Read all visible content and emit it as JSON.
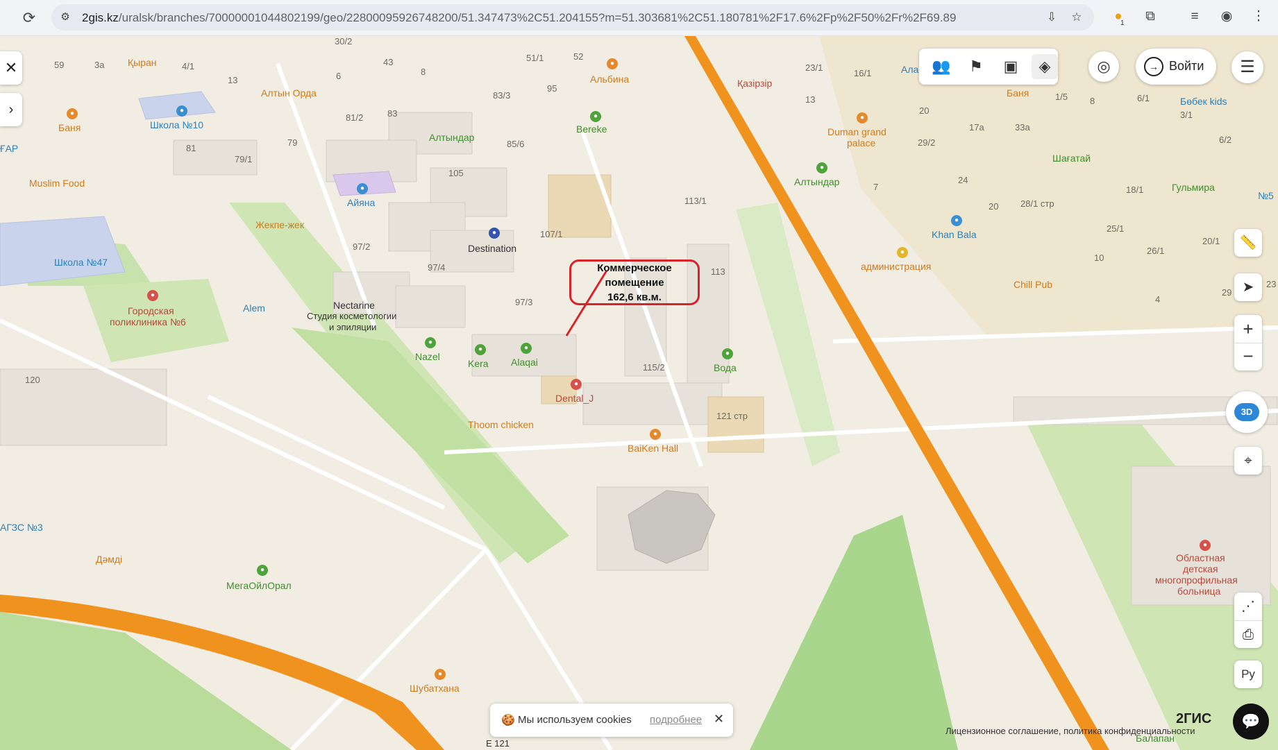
{
  "browser": {
    "url_host": "2gis.kz",
    "url_path": "/uralsk/branches/70000001044802199/geo/22800095926748200/51.347473%2C51.204155?m=51.303681%2C51.180781%2F17.6%2Fp%2F50%2Fr%2F69.89",
    "icons": [
      "reload-icon",
      "site-info-icon",
      "install-app-icon",
      "star-icon",
      "extension-badge-icon",
      "puzzle-icon",
      "media-icon",
      "profile-icon",
      "more-icon"
    ],
    "extension_badge": "1"
  },
  "map_ui": {
    "login_label": "Войти",
    "tools_icons": [
      "friends-icon",
      "directions-icon",
      "photo-icon",
      "layers-icon",
      "circle-icon",
      "menu-icon"
    ],
    "right_controls_icons": [
      "ruler-icon",
      "locate-icon",
      "zoom-in-icon",
      "zoom-out-icon",
      "compass-3d-icon",
      "map-pin-icon",
      "share-icon",
      "print-icon"
    ],
    "mode_3d_label": "3D",
    "language_label": "Ру",
    "cookie_text": "Мы используем cookies",
    "cookie_more": "подробнее",
    "brand": "2ГИС",
    "license": "Лицензионное соглашение, политика конфиденциальности"
  },
  "annotation": {
    "text": "Коммерческое\nпомещение\n162,6 кв.м.",
    "color": "#d8232a"
  },
  "map_labels": {
    "kyran": "Қыран",
    "altyn_orda": "Алтын Орда",
    "albina": "Альбина",
    "kazirzhr": "Қазірзір",
    "banya_l": "Баня",
    "shkola10": "Школа №10",
    "far": "ҒАР",
    "muslim_food": "Muslim Food",
    "shkola47": "Школа №47",
    "altyndar_top": "Алтындар",
    "bereke": "Bereke",
    "ayana": "Айяна",
    "zhekpe": "Жекпе-жек",
    "destination": "Destination",
    "nectarine": "Nectarine",
    "studio": "Студия косметологии",
    "epil": "и эпиляции",
    "alem": "Alem",
    "polyclinic1": "Городская",
    "polyclinic2": "поликлиника №6",
    "nazel": "Nazel",
    "kera": "Kera",
    "alaqai": "Alaqai",
    "voda": "Вода",
    "dental": "Dental_J",
    "thoom": "Thoom chicken",
    "baiken": "BaiKen Hall",
    "duman1": "Duman grand",
    "duman2": "palace",
    "altyndar_r": "Алтындар",
    "khan_bala": "Khan Bala",
    "admin": "администрация",
    "chill_pub": "Chill Pub",
    "banya_r": "Баня",
    "bobek": "Бөбек kids",
    "shagatai": "Шағатай",
    "gulmira": "Гульмира",
    "no5": "№5",
    "ala": "Ала",
    "azs": "АГЗС №3",
    "damdi": "Дәмді",
    "megaoil": "МегаОйлОрал",
    "shubatkhana": "Шубатхана",
    "hosp1": "Областная",
    "hosp2": "детская",
    "hosp3": "многопрофильная",
    "hosp4": "больница",
    "balapan": "Балапан",
    "e121": "E 121"
  },
  "house_numbers": {
    "n59": "59",
    "n3a": "3а",
    "n41": "4/1",
    "n302": "30/2",
    "n43": "43",
    "n511": "51/1",
    "n52": "52",
    "n13a": "13",
    "n6": "6",
    "n8": "8",
    "n95": "95",
    "n833": "83/3",
    "n812": "81/2",
    "n83": "83",
    "n856": "85/6",
    "n81": "81",
    "n791": "79/1",
    "n79": "79",
    "n105": "105",
    "n972": "97/2",
    "n974": "97/4",
    "n973": "97/3",
    "n1071": "107/1",
    "n1131": "113/1",
    "n113": "113",
    "n1152": "115/2",
    "n121": "121 стр",
    "n120": "120",
    "n231": "23/1",
    "n161": "16/1",
    "n13b": "13",
    "n7": "7",
    "n15": "1/5",
    "n8b": "8",
    "n61": "6/1",
    "n31": "3/1",
    "n20a": "20",
    "n17a": "17а",
    "n33a": "33а",
    "n292": "29/2",
    "n62": "6/2",
    "n24": "24",
    "n181": "18/1",
    "n20b": "20",
    "n281": "28/1 стр",
    "n251": "25/1",
    "n201": "20/1",
    "n10": "10",
    "n261": "26/1",
    "n23": "23",
    "n29": "29",
    "n4": "4"
  }
}
